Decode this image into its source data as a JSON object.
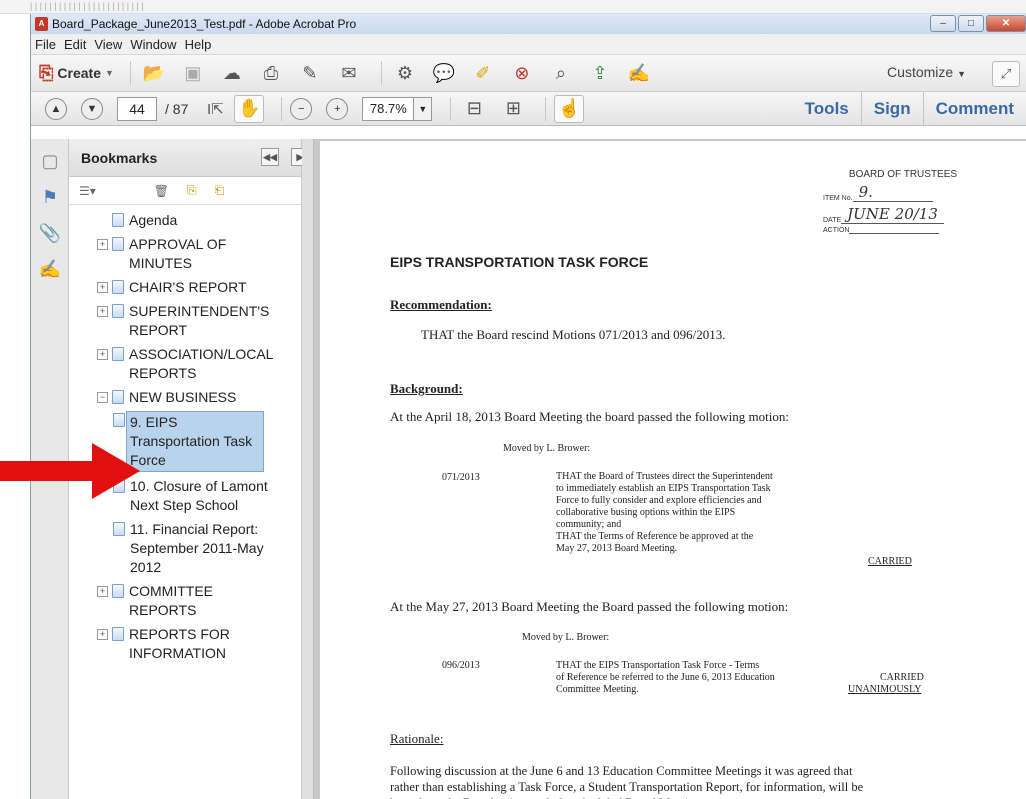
{
  "topstrip_text": "|  |  |  |  |  |  |  |  |  |  |  |  |  |  |  |  |  |  |  |  |  |  |  |",
  "window": {
    "title": "Board_Package_June2013_Test.pdf - Adobe Acrobat Pro",
    "controls": {
      "minimize": "–",
      "maximize": "□",
      "close": "✕"
    }
  },
  "menu": [
    "File",
    "Edit",
    "View",
    "Window",
    "Help"
  ],
  "toolbar1": {
    "create_label": "Create",
    "customize_label": "Customize",
    "icons": [
      "open-folder-icon",
      "save-icon",
      "cloud-upload-icon",
      "print-icon",
      "edit-icon",
      "email-icon",
      "settings-icon",
      "comment-bubble-icon",
      "highlight-icon",
      "pdf-remove-icon",
      "pdf-search-icon",
      "pdf-export-icon",
      "pdf-edit-icon"
    ]
  },
  "toolbar2": {
    "page_current": "44",
    "page_total": "/ 87",
    "zoom": "78.7%",
    "tools_label": "Tools",
    "sign_label": "Sign",
    "comment_label": "Comment"
  },
  "panel": {
    "title": "Bookmarks",
    "bookmarks": [
      {
        "label": "Agenda",
        "expand": ""
      },
      {
        "label": "APPROVAL OF MINUTES",
        "expand": "+"
      },
      {
        "label": "CHAIR'S REPORT",
        "expand": "+"
      },
      {
        "label": "SUPERINTENDENT'S REPORT",
        "expand": "+"
      },
      {
        "label": "ASSOCIATION/LOCAL REPORTS",
        "expand": "+"
      },
      {
        "label": "NEW BUSINESS",
        "expand": "−"
      },
      {
        "label": "9. EIPS Transportation Task Force",
        "expand": "",
        "selected": true
      },
      {
        "label": "10. Closure of Lamont Next Step School",
        "expand": ""
      },
      {
        "label": "11. Financial Report: September 2011-May 2012",
        "expand": ""
      },
      {
        "label": "COMMITTEE REPORTS",
        "expand": "+"
      },
      {
        "label": "REPORTS FOR INFORMATION",
        "expand": "+"
      }
    ]
  },
  "document": {
    "stamp": {
      "title": "BOARD OF TRUSTEES",
      "item_label": "ITEM No.",
      "item_value": "9.",
      "date_label": "DATE",
      "date_value": "JUNE 20/13",
      "action_label": "ACTION"
    },
    "title": "EIPS TRANSPORTATION TASK FORCE",
    "recommendation_heading": "Recommendation:",
    "recommendation_text": "THAT the Board rescind Motions 071/2013 and 096/2013.",
    "background_heading": "Background:",
    "background_intro": "At the April 18, 2013 Board Meeting the board passed the following motion:",
    "motion1": {
      "moved_by": "Moved by L. Brower:",
      "number": "071/2013",
      "text_lines": [
        "THAT the Board of Trustees direct the Superintendent",
        "to immediately establish an EIPS Transportation Task",
        "Force to fully consider and explore efficiencies and",
        "collaborative busing options within the EIPS",
        "community; and",
        "THAT the Terms of Reference be approved at the",
        "May 27, 2013 Board Meeting."
      ],
      "status": "CARRIED"
    },
    "second_intro": "At the May 27, 2013 Board Meeting the Board passed the following motion:",
    "motion2": {
      "moved_by": "Moved by L. Brower:",
      "number": "096/2013",
      "text_lines": [
        "THAT the EIPS Transportation Task Force - Terms",
        "of Reference be referred to the June 6, 2013 Education",
        "Committee Meeting."
      ],
      "status_line1": "CARRIED",
      "status_line2": "UNANIMOUSLY"
    },
    "rationale_heading": "Rationale:",
    "rationale_lines": [
      "Following discussion at the June 6 and 13 Education Committee Meetings it was agreed that",
      "rather than establishing a Task Force, a Student Transportation Report, for information, will be",
      "brought to the Board at its regularly scheduled Board Meetings."
    ]
  },
  "colors": {
    "arrow": "#e01010",
    "link": "#3a6aa5",
    "selection": "#b9d3ec"
  }
}
